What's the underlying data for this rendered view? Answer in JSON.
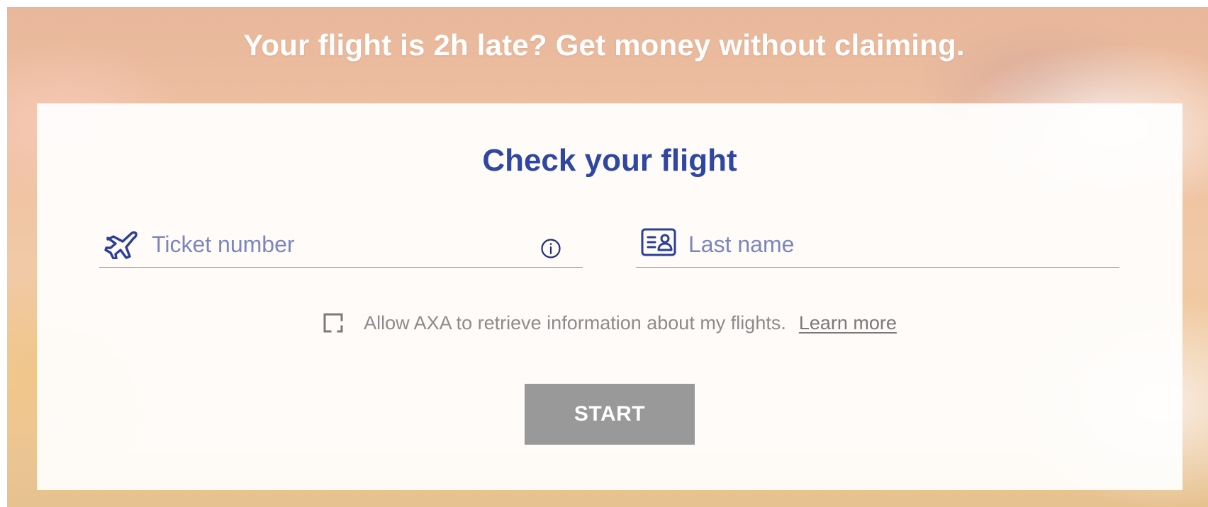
{
  "hero": {
    "headline": "Your flight is 2h late? Get money without claiming."
  },
  "form": {
    "title": "Check your flight",
    "ticket_field": {
      "icon": "airplane-icon",
      "placeholder": "Ticket number",
      "value": "",
      "help_icon": "info-icon"
    },
    "name_field": {
      "icon": "id-card-icon",
      "placeholder": "Last name",
      "value": ""
    },
    "consent": {
      "checked": false,
      "label": "Allow AXA to retrieve information about my flights.",
      "link_label": "Learn more"
    },
    "start_label": "START"
  },
  "colors": {
    "accent": "#2f47a1",
    "button_disabled": "#999999",
    "text_muted": "#8c8c8c"
  }
}
